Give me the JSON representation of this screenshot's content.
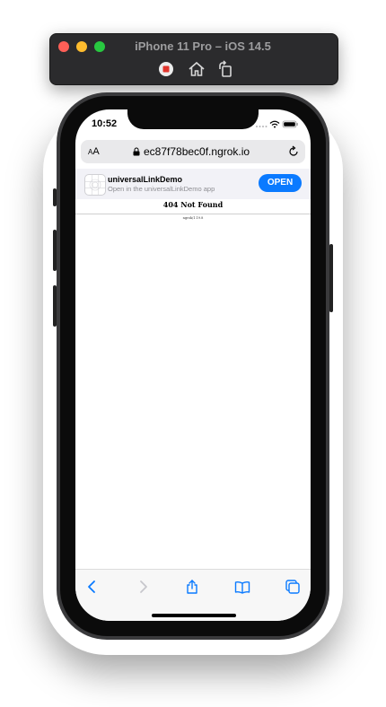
{
  "simulator": {
    "title": "iPhone 11 Pro – iOS 14.5",
    "tools": [
      "record-icon",
      "home-icon",
      "rotate-icon"
    ]
  },
  "status_bar": {
    "time": "10:52",
    "icons": [
      "signal-icon",
      "wifi-icon",
      "battery-icon"
    ]
  },
  "url_bar": {
    "text_size_label": "AA",
    "url": "ec87f78bec0f.ngrok.io",
    "icons": [
      "lock-icon",
      "reload-icon"
    ]
  },
  "app_banner": {
    "app_name": "universalLinkDemo",
    "subtitle": "Open in the universalLinkDemo app",
    "open_label": "OPEN"
  },
  "page": {
    "heading": "404 Not Found",
    "footer": "ngrok/1.19.8"
  },
  "toolbar": {
    "buttons": [
      "back-icon",
      "forward-icon",
      "share-icon",
      "bookmarks-icon",
      "tabs-icon"
    ]
  },
  "colors": {
    "accent": "#0a7aff",
    "disabled": "#c7c7cc"
  }
}
